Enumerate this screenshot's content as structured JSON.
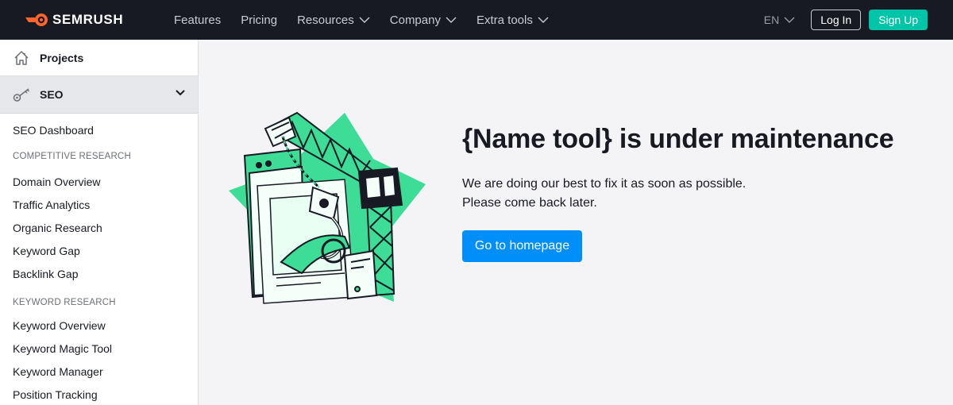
{
  "header": {
    "brand": "SEMRUSH",
    "nav": [
      {
        "label": "Features",
        "dropdown": false
      },
      {
        "label": "Pricing",
        "dropdown": false
      },
      {
        "label": "Resources",
        "dropdown": true
      },
      {
        "label": "Company",
        "dropdown": true
      },
      {
        "label": "Extra tools",
        "dropdown": true
      }
    ],
    "language": "EN",
    "login_label": "Log In",
    "signup_label": "Sign Up"
  },
  "sidebar": {
    "projects_label": "Projects",
    "seo_label": "SEO",
    "items": {
      "seo_dashboard": "SEO Dashboard",
      "competitive_research": "COMPETITIVE RESEARCH",
      "domain_overview": "Domain Overview",
      "traffic_analytics": "Traffic Analytics",
      "organic_research": "Organic Research",
      "keyword_gap": "Keyword Gap",
      "backlink_gap": "Backlink Gap",
      "keyword_research": "KEYWORD RESEARCH",
      "keyword_overview": "Keyword Overview",
      "keyword_magic_tool": "Keyword Magic Tool",
      "keyword_manager": "Keyword Manager",
      "position_tracking": "Position Tracking"
    }
  },
  "main": {
    "title": "{Name tool} is under maintenance",
    "line1": "We are doing our best to fix it as soon as possible.",
    "line2": "Please come back later.",
    "button_label": "Go to homepage"
  },
  "colors": {
    "topbar_bg": "#171a22",
    "brand_orange": "#ff642d",
    "signup_green": "#00c4a7",
    "primary_blue": "#008ff8",
    "illustration_green": "#3ddc97",
    "page_bg": "#f4f4f6"
  },
  "icons": {
    "projects": "home-icon",
    "seo": "key-icon",
    "collapse": "chevron-down-icon"
  }
}
